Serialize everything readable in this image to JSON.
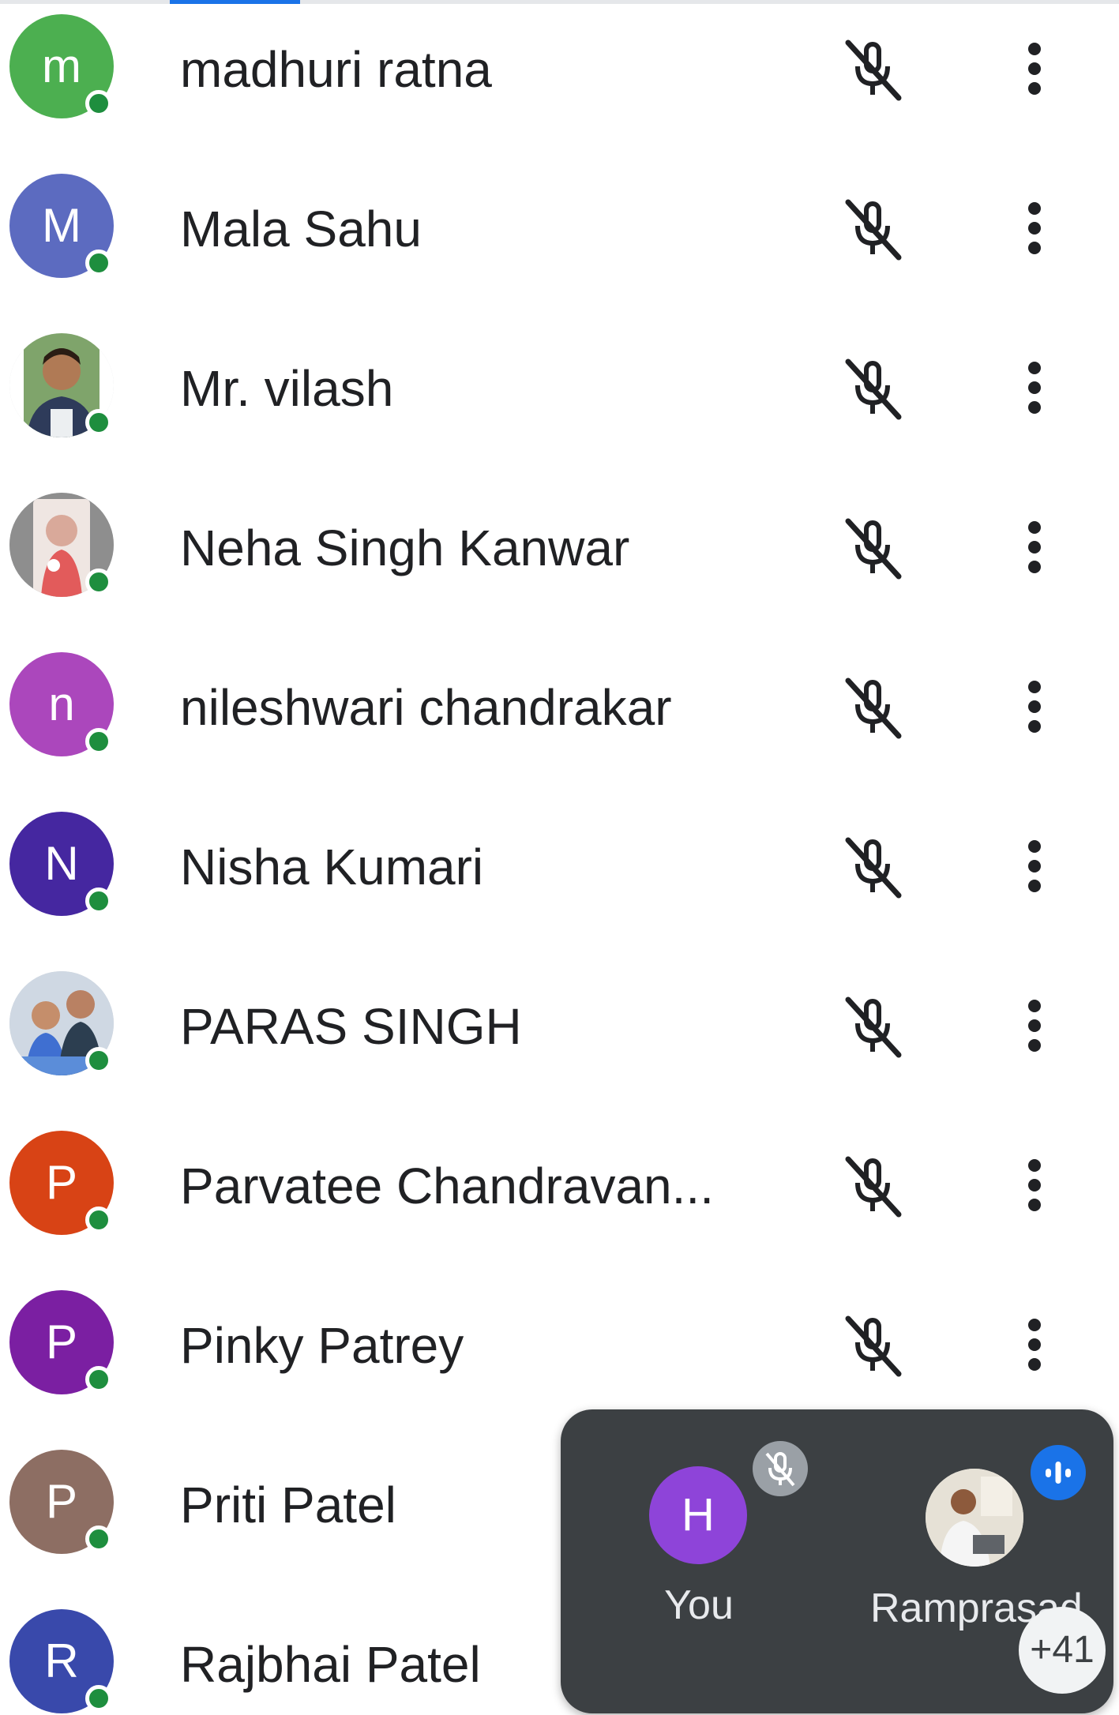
{
  "participants": [
    {
      "name": "madhuri ratna",
      "initial": "m",
      "avatar_color": "#4caf50",
      "photo": false
    },
    {
      "name": "Mala Sahu",
      "initial": "M",
      "avatar_color": "#5c6bc0",
      "photo": false
    },
    {
      "name": "Mr. vilash",
      "initial": "",
      "avatar_color": "#9e9e9e",
      "photo": true
    },
    {
      "name": "Neha Singh Kanwar",
      "initial": "",
      "avatar_color": "#9e9e9e",
      "photo": true
    },
    {
      "name": "nileshwari chandrakar",
      "initial": "n",
      "avatar_color": "#ab47bc",
      "photo": false
    },
    {
      "name": "Nisha Kumari",
      "initial": "N",
      "avatar_color": "#4527a0",
      "photo": false
    },
    {
      "name": "PARAS SINGH",
      "initial": "",
      "avatar_color": "#9e9e9e",
      "photo": true
    },
    {
      "name": "Parvatee Chandravan...",
      "initial": "P",
      "avatar_color": "#d84315",
      "photo": false
    },
    {
      "name": "Pinky Patrey",
      "initial": "P",
      "avatar_color": "#7b1fa2",
      "photo": false
    },
    {
      "name": "Priti Patel",
      "initial": "P",
      "avatar_color": "#8d6e63",
      "photo": false
    },
    {
      "name": "Rajbhai Patel",
      "initial": "R",
      "avatar_color": "#3949ab",
      "photo": false
    }
  ],
  "icons": {
    "mic": "mic-off-icon",
    "more": "more-vert-icon",
    "presence": "online-presence-dot"
  },
  "call_tile": {
    "self_initial": "H",
    "self_label": "You",
    "other_label": "Ramprasad",
    "more_count": "+41",
    "self_muted": true,
    "other_speaking": true
  },
  "colors": {
    "presence": "#1e8e3e",
    "tile_bg": "#3c4043",
    "speaking": "#1a73e8"
  }
}
